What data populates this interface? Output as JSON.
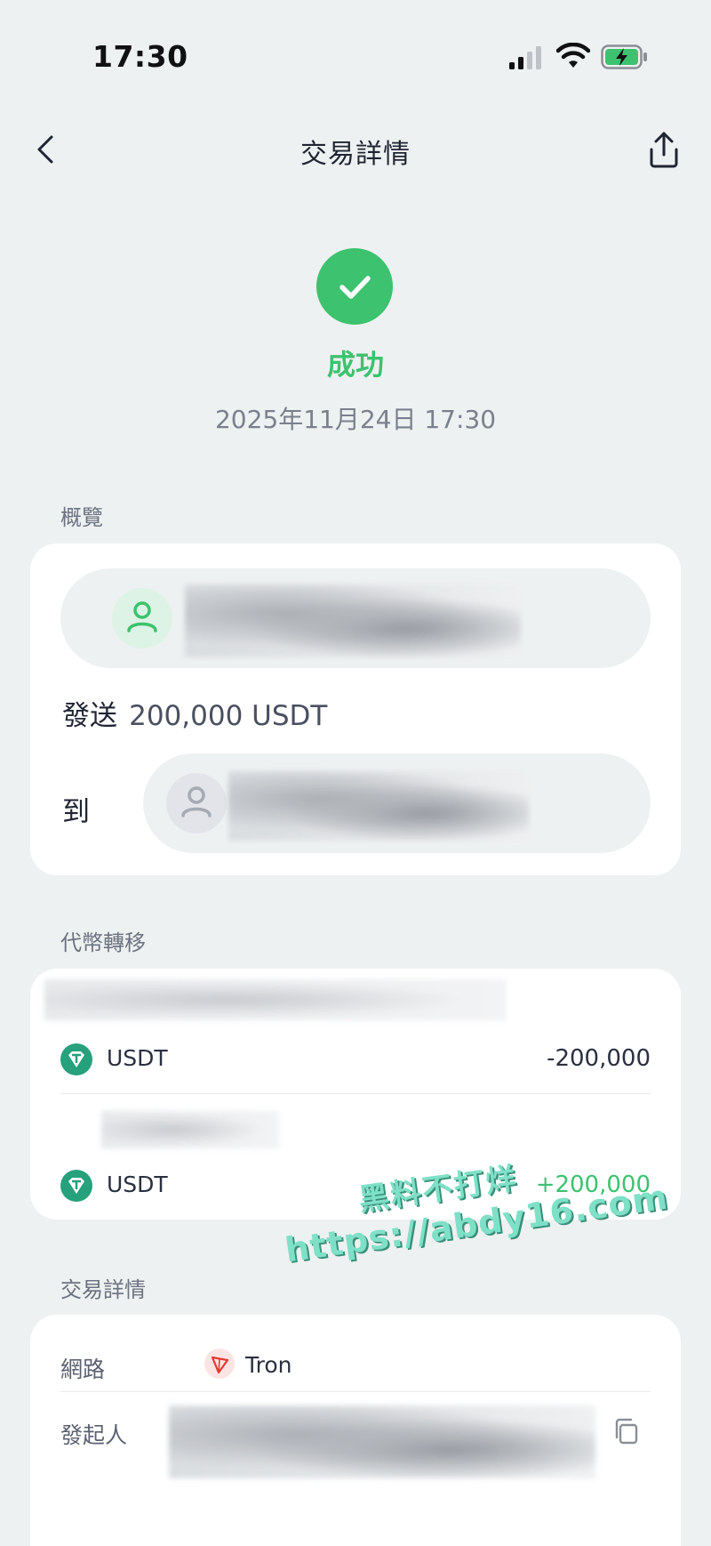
{
  "status_bar": {
    "time": "17:30",
    "icons": [
      "signal-icon",
      "wifi-icon",
      "battery-charging-icon"
    ]
  },
  "nav": {
    "title": "交易詳情",
    "back_icon": "chevron-left-icon",
    "share_icon": "share-icon"
  },
  "status": {
    "label": "成功",
    "datetime": "2025年11月24日 17:30",
    "icon": "check-icon",
    "color": "#3DC26F"
  },
  "overview": {
    "section_label": "概覽",
    "send_label": "發送",
    "send_amount": "200,000 USDT",
    "to_label": "到"
  },
  "token_transfer": {
    "section_label": "代幣轉移",
    "rows": [
      {
        "token": "USDT",
        "amount": "-200,000"
      },
      {
        "token": "USDT",
        "amount": "+200,000"
      }
    ]
  },
  "details": {
    "section_label": "交易詳情",
    "rows": [
      {
        "key": "網路",
        "value": "Tron",
        "icon": "tron-icon"
      },
      {
        "key": "發起人",
        "value": "",
        "icon": "copy-icon"
      }
    ]
  },
  "watermark": {
    "line1": "黑料不打烊",
    "line2": "https://abdy16.com"
  },
  "colors": {
    "background": "#EEF1F1",
    "success": "#3DC26F",
    "tether": "#26A17B",
    "tron": "#E53935"
  }
}
